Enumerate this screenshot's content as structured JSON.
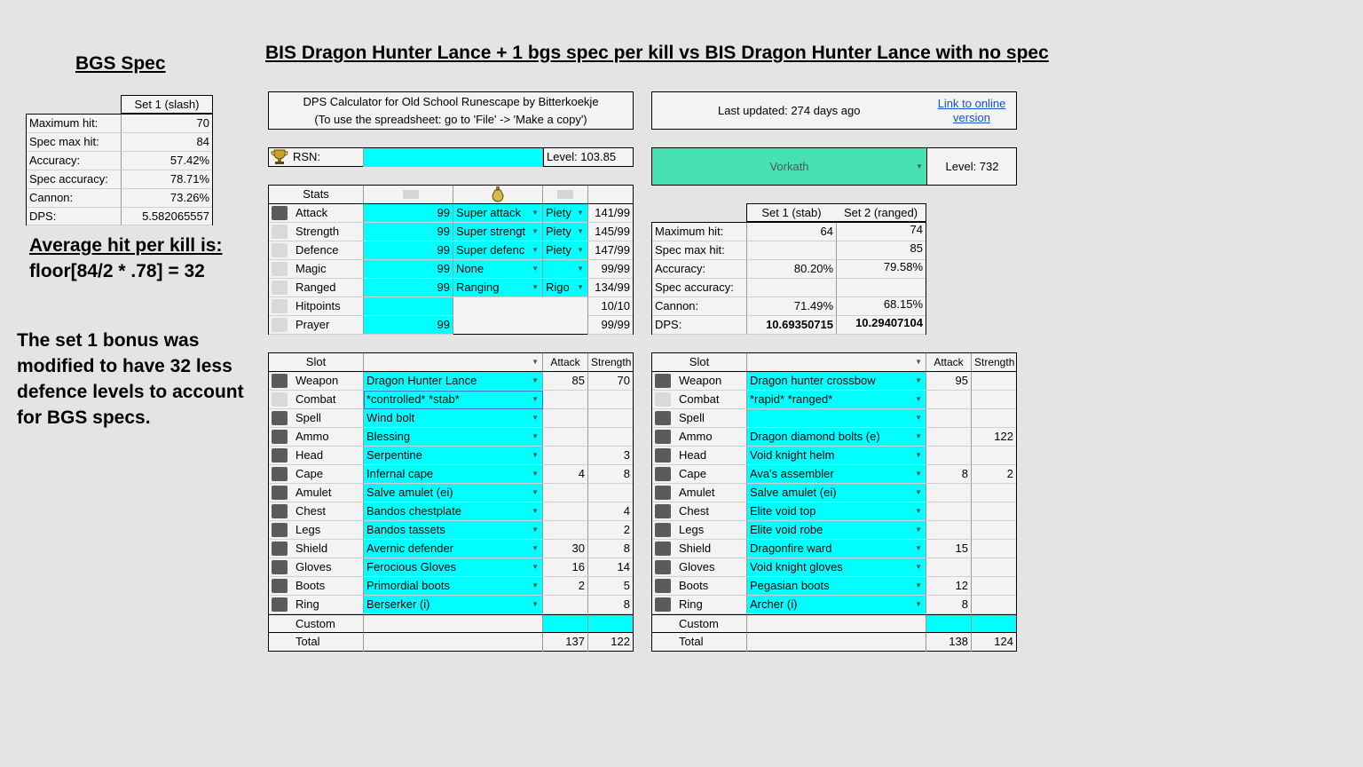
{
  "left": {
    "bgs_title": "BGS Spec",
    "set_header": "Set 1 (slash)",
    "rows": [
      {
        "label": "Maximum hit:",
        "value": "70"
      },
      {
        "label": "Spec max hit:",
        "value": "84"
      },
      {
        "label": "Accuracy:",
        "value": "57.42%"
      },
      {
        "label": "Spec accuracy:",
        "value": "78.71%"
      },
      {
        "label": "Cannon:",
        "value": "73.26%"
      },
      {
        "label": "DPS:",
        "value": "5.582065557"
      }
    ],
    "avg_line1": "Average hit per kill is:",
    "avg_line2": "floor[84/2 * .78] = 32",
    "note": "The set 1 bonus was modified to have 32 less defence levels to account for BGS specs."
  },
  "main_title": "BIS Dragon Hunter Lance + 1 bgs spec per kill vs BIS Dragon Hunter Lance with no spec",
  "calc": {
    "line1": "DPS Calculator for Old School Runescape by Bitterkoekje",
    "line2": "(To use the spreadsheet: go to 'File' -> 'Make a copy')",
    "updated": "Last updated: 274 days ago",
    "link": "Link to online version"
  },
  "rsn": {
    "label": "RSN:",
    "value": "",
    "level": "Level: 103.85"
  },
  "monster": {
    "name": "Vorkath",
    "level": "Level: 732"
  },
  "stats": {
    "header": "Stats",
    "rows": [
      {
        "name": "Attack",
        "level": "99",
        "potion": "Super attack",
        "prayer": "Piety",
        "eff": "141/99"
      },
      {
        "name": "Strength",
        "level": "99",
        "potion": "Super strengt",
        "prayer": "Piety",
        "eff": "145/99"
      },
      {
        "name": "Defence",
        "level": "99",
        "potion": "Super defenc",
        "prayer": "Piety",
        "eff": "147/99"
      },
      {
        "name": "Magic",
        "level": "99",
        "potion": "None",
        "prayer": "",
        "eff": "99/99"
      },
      {
        "name": "Ranged",
        "level": "99",
        "potion": "Ranging",
        "prayer": "Rigo",
        "eff": "134/99"
      },
      {
        "name": "Hitpoints",
        "level": "",
        "potion": "",
        "prayer": "",
        "eff": "10/10"
      },
      {
        "name": "Prayer",
        "level": "99",
        "potion": "",
        "prayer": "",
        "eff": "99/99"
      }
    ]
  },
  "results": {
    "set1_header": "Set 1 (stab)",
    "set2_header": "Set 2 (ranged)",
    "rows": [
      {
        "label": "Maximum hit:",
        "v1": "64",
        "v2": "74"
      },
      {
        "label": "Spec max hit:",
        "v1": "",
        "v2": "85"
      },
      {
        "label": "Accuracy:",
        "v1": "80.20%",
        "v2": "79.58%"
      },
      {
        "label": "Spec accuracy:",
        "v1": "",
        "v2": ""
      },
      {
        "label": "Cannon:",
        "v1": "71.49%",
        "v2": "68.15%"
      },
      {
        "label": "DPS:",
        "v1": "10.69350715",
        "v2": "10.29407104"
      }
    ]
  },
  "gear_headers": {
    "slot": "Slot",
    "attack": "Attack",
    "strength": "Strength",
    "custom": "Custom",
    "total": "Total"
  },
  "gear1": {
    "rows": [
      {
        "slot": "Weapon",
        "item": "Dragon Hunter Lance",
        "atk": "85",
        "str": "70"
      },
      {
        "slot": "Combat",
        "item": "*controlled* *stab*",
        "atk": "",
        "str": ""
      },
      {
        "slot": "Spell",
        "item": "Wind bolt",
        "atk": "",
        "str": ""
      },
      {
        "slot": "Ammo",
        "item": "Blessing",
        "atk": "",
        "str": ""
      },
      {
        "slot": "Head",
        "item": "Serpentine",
        "atk": "",
        "str": "3"
      },
      {
        "slot": "Cape",
        "item": "Infernal cape",
        "atk": "4",
        "str": "8"
      },
      {
        "slot": "Amulet",
        "item": "Salve amulet (ei)",
        "atk": "",
        "str": ""
      },
      {
        "slot": "Chest",
        "item": "Bandos chestplate",
        "atk": "",
        "str": "4"
      },
      {
        "slot": "Legs",
        "item": "Bandos tassets",
        "atk": "",
        "str": "2"
      },
      {
        "slot": "Shield",
        "item": "Avernic defender",
        "atk": "30",
        "str": "8"
      },
      {
        "slot": "Gloves",
        "item": "Ferocious Gloves",
        "atk": "16",
        "str": "14"
      },
      {
        "slot": "Boots",
        "item": "Primordial boots",
        "atk": "2",
        "str": "5"
      },
      {
        "slot": "Ring",
        "item": "Berserker (i)",
        "atk": "",
        "str": "8"
      }
    ],
    "total_atk": "137",
    "total_str": "122"
  },
  "gear2": {
    "rows": [
      {
        "slot": "Weapon",
        "item": "Dragon hunter crossbow",
        "atk": "95",
        "str": ""
      },
      {
        "slot": "Combat",
        "item": "*rapid* *ranged*",
        "atk": "",
        "str": ""
      },
      {
        "slot": "Spell",
        "item": "",
        "atk": "",
        "str": ""
      },
      {
        "slot": "Ammo",
        "item": "Dragon diamond bolts (e)",
        "atk": "",
        "str": "122"
      },
      {
        "slot": "Head",
        "item": "Void knight helm",
        "atk": "",
        "str": ""
      },
      {
        "slot": "Cape",
        "item": "Ava's assembler",
        "atk": "8",
        "str": "2"
      },
      {
        "slot": "Amulet",
        "item": "Salve amulet (ei)",
        "atk": "",
        "str": ""
      },
      {
        "slot": "Chest",
        "item": "Elite void top",
        "atk": "",
        "str": ""
      },
      {
        "slot": "Legs",
        "item": "Elite void robe",
        "atk": "",
        "str": ""
      },
      {
        "slot": "Shield",
        "item": "Dragonfire ward",
        "atk": "15",
        "str": ""
      },
      {
        "slot": "Gloves",
        "item": "Void knight gloves",
        "atk": "",
        "str": ""
      },
      {
        "slot": "Boots",
        "item": "Pegasian boots",
        "atk": "12",
        "str": ""
      },
      {
        "slot": "Ring",
        "item": "Archer (i)",
        "atk": "8",
        "str": ""
      }
    ],
    "total_atk": "138",
    "total_str": "124"
  },
  "colors": {
    "cyan": "#00ffff",
    "monster_green": "#46e2b4",
    "link": "#1155cc"
  }
}
